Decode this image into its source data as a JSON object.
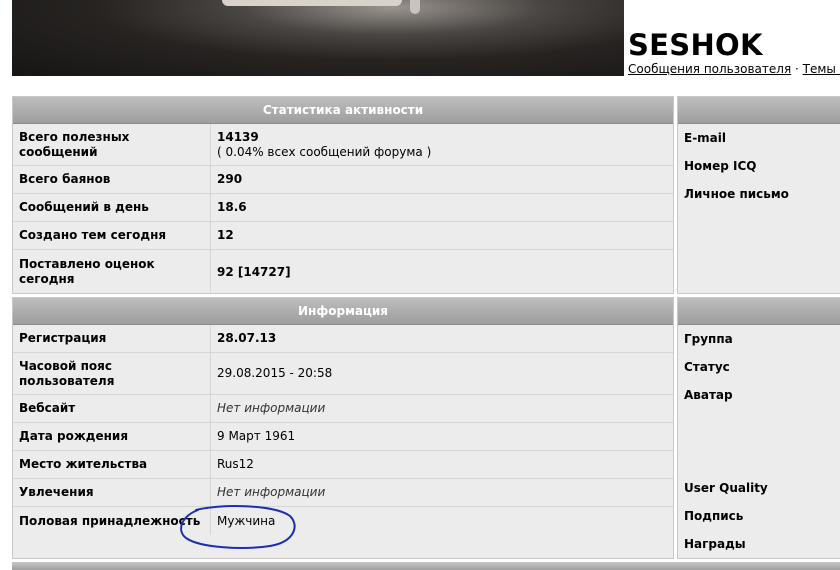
{
  "profile": {
    "username": "SESHOK",
    "links": [
      {
        "label": "Сообщения пользователя"
      },
      {
        "label": "Темы п"
      }
    ],
    "links_separator": " · "
  },
  "stats": {
    "title": "Статистика активности",
    "rows": [
      {
        "label": "Всего полезных сообщений",
        "value": "14139",
        "sub": "( 0.04% всех сообщений форума )"
      },
      {
        "label": "Всего баянов",
        "value": "290"
      },
      {
        "label": "Сообщений в день",
        "value": "18.6"
      },
      {
        "label": "Создано тем сегодня",
        "value": "12"
      },
      {
        "label": "Поставлено оценок сегодня",
        "value": "92 [14727]"
      }
    ]
  },
  "contacts": {
    "rows": [
      {
        "label": "E-mail"
      },
      {
        "label": "Номер ICQ"
      },
      {
        "label": "Личное письмо"
      }
    ]
  },
  "info": {
    "title": "Информация",
    "rows": [
      {
        "label": "Регистрация",
        "value": "28.07.13"
      },
      {
        "label": "Часовой пояс пользователя",
        "value": "29.08.2015 - 20:58"
      },
      {
        "label": "Вебсайт",
        "value": "Нет информации"
      },
      {
        "label": "Дата рождения",
        "value": "9 Март 1961"
      },
      {
        "label": "Место жительства",
        "value": "Rus12"
      },
      {
        "label": "Увлечения",
        "value": "Нет информации"
      },
      {
        "label": "Половая принадлежность",
        "value": "Мужчина"
      }
    ]
  },
  "details": {
    "rows": [
      {
        "label": "Группа"
      },
      {
        "label": "Статус"
      },
      {
        "label": "Аватар"
      },
      {
        "label": "User Quality"
      },
      {
        "label": "Подпись"
      },
      {
        "label": "Награды"
      }
    ]
  },
  "colors": {
    "header_gradient_top": "#bdbdbd",
    "header_gradient_bottom": "#9e9e9e",
    "panel_bg": "#ececec",
    "annotation_circle": "#1a2fb0"
  }
}
